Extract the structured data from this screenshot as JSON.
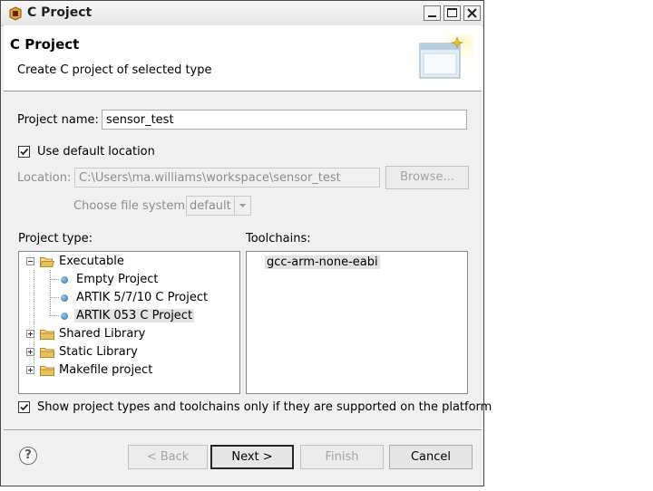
{
  "window": {
    "title": "C Project"
  },
  "banner": {
    "title": "C Project",
    "description": "Create C project of selected type"
  },
  "form": {
    "project_name_label": "Project name:",
    "project_name_value": "sensor_test",
    "use_default_location_label": "Use default location",
    "use_default_location_checked": true,
    "location_label": "Location:",
    "location_value": "C:\\Users\\ma.williams\\workspace\\sensor_test",
    "browse_label": "Browse...",
    "file_system_label": "Choose file system:",
    "file_system_value": "default"
  },
  "project_type": {
    "label": "Project type:",
    "items": [
      {
        "label": "Executable",
        "kind": "folder",
        "expanded": true
      },
      {
        "label": "Empty Project",
        "kind": "leaf"
      },
      {
        "label": "ARTIK 5/7/10 C Project",
        "kind": "leaf"
      },
      {
        "label": "ARTIK 053 C Project",
        "kind": "leaf",
        "selected": true
      },
      {
        "label": "Shared Library",
        "kind": "folder",
        "expanded": false
      },
      {
        "label": "Static Library",
        "kind": "folder",
        "expanded": false
      },
      {
        "label": "Makefile project",
        "kind": "folder",
        "expanded": false
      }
    ]
  },
  "toolchains": {
    "label": "Toolchains:",
    "items": [
      "gcc-arm-none-eabi"
    ]
  },
  "filter": {
    "label": "Show project types and toolchains only if they are supported on the platform",
    "checked": true
  },
  "buttons": {
    "back": "< Back",
    "next": "Next >",
    "finish": "Finish",
    "cancel": "Cancel",
    "help": "?"
  },
  "colors": {
    "selection": "#e3e3e3",
    "bullet": "#2c6aa8",
    "folder": "#e8c15e"
  }
}
